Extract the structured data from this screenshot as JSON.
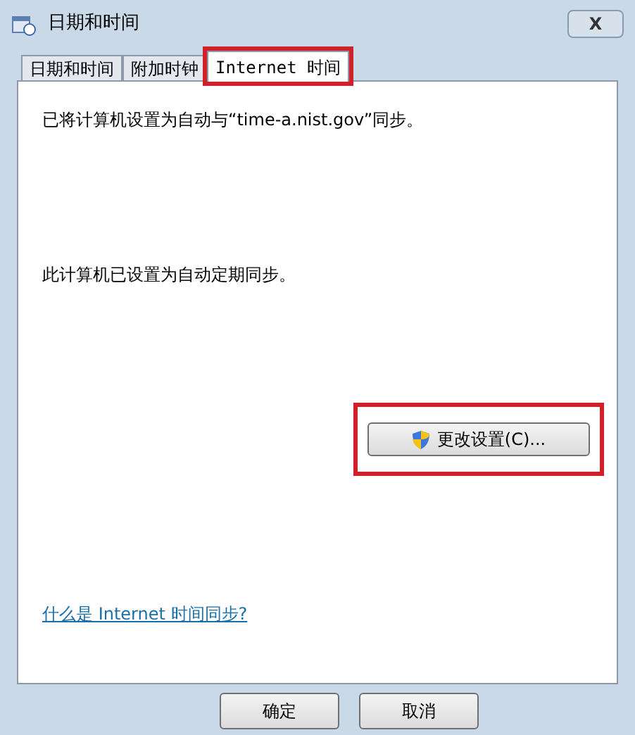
{
  "window": {
    "title": "日期和时间",
    "close": "X"
  },
  "tabs": [
    {
      "label": "日期和时间",
      "selected": false,
      "highlighted": false
    },
    {
      "label": "附加时钟",
      "selected": false,
      "highlighted": false
    },
    {
      "label": "Internet 时间",
      "selected": true,
      "highlighted": true
    }
  ],
  "messages": [
    "已将计算机设置为自动与“time-a.nist.gov”同步。",
    "此计算机已设置为自动定期同步。"
  ],
  "change_button": {
    "label": "更改设置(C)...",
    "highlighted": true
  },
  "help_link": "什么是 Internet 时间同步?",
  "buttons": [
    "确定",
    "取消"
  ]
}
